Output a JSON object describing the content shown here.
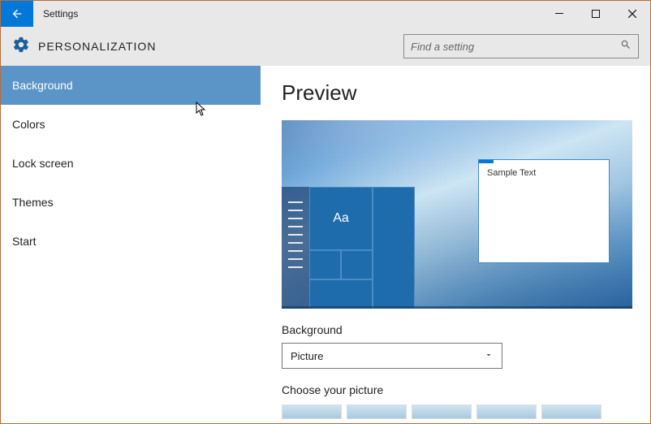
{
  "window": {
    "title": "Settings"
  },
  "header": {
    "title": "PERSONALIZATION",
    "search_placeholder": "Find a setting"
  },
  "sidebar": {
    "items": [
      {
        "label": "Background",
        "selected": true
      },
      {
        "label": "Colors",
        "selected": false
      },
      {
        "label": "Lock screen",
        "selected": false
      },
      {
        "label": "Themes",
        "selected": false
      },
      {
        "label": "Start",
        "selected": false
      }
    ]
  },
  "main": {
    "preview_title": "Preview",
    "sample_text": "Sample Text",
    "tile_label": "Aa",
    "background_label": "Background",
    "background_select_value": "Picture",
    "choose_picture_label": "Choose your picture"
  },
  "colors": {
    "accent": "#0078d7",
    "titlebar_bg": "#e8e8e8",
    "sidebar_selected": "#5b94c6"
  }
}
